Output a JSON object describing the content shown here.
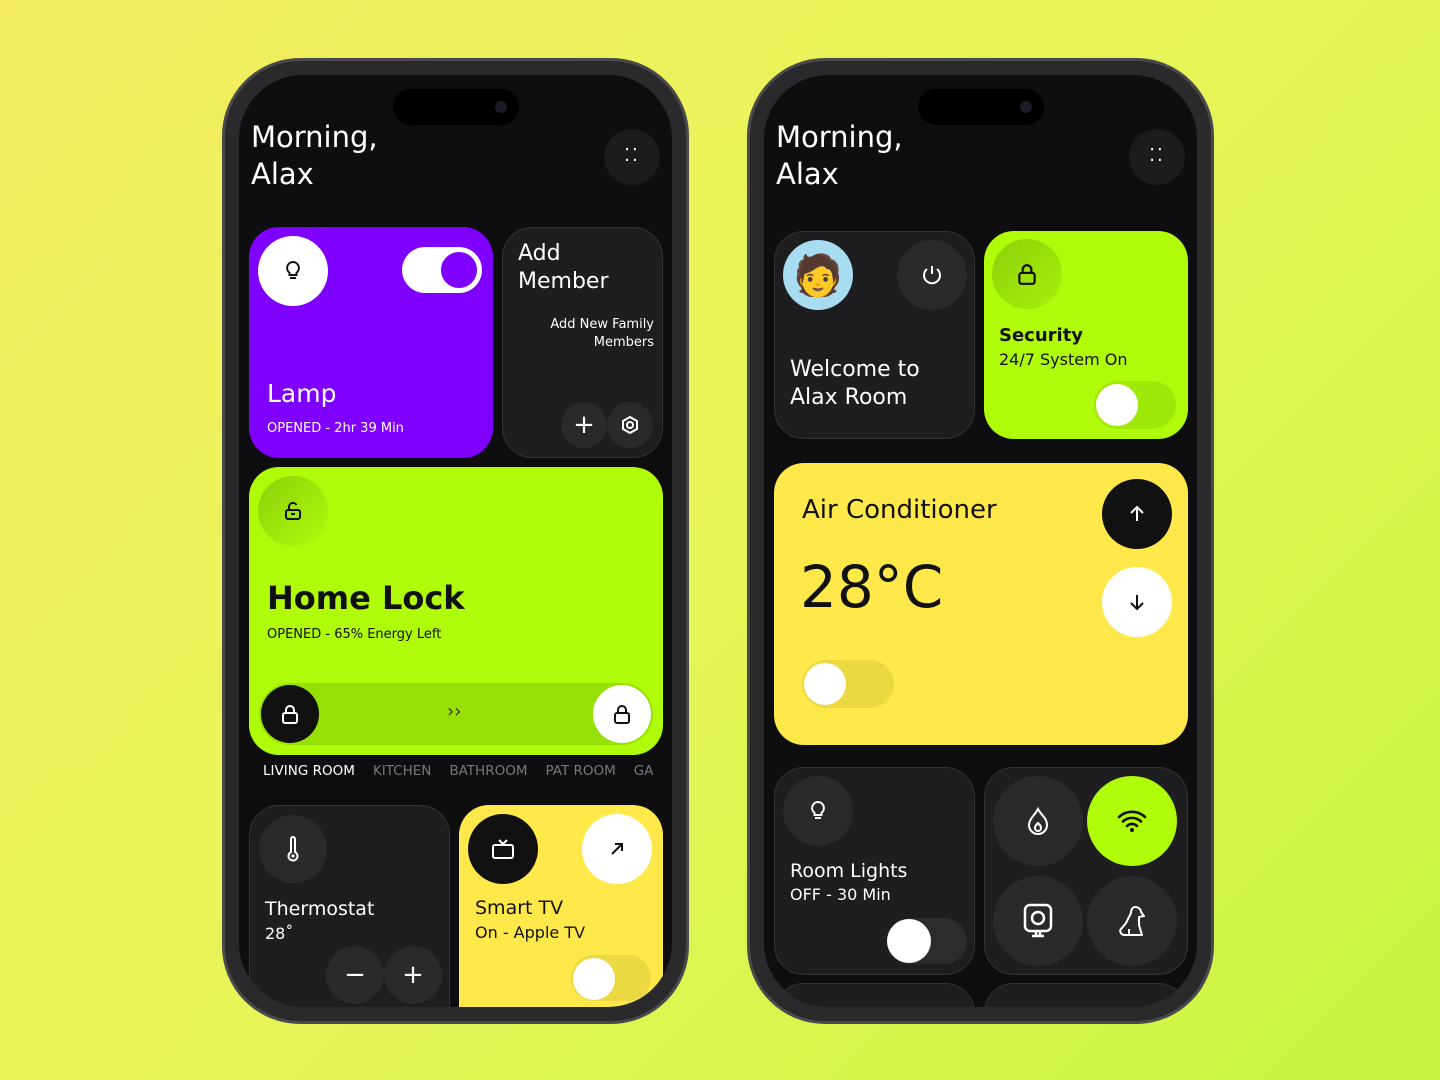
{
  "colors": {
    "purple": "#7f00ff",
    "lime": "#b0fb0a",
    "yellow": "#ffe94a",
    "dark": "#1e1e20"
  },
  "left": {
    "greeting_line1": "Morning,",
    "greeting_line2": "Alax",
    "menu_icon": "dots-grid-icon",
    "lamp": {
      "title": "Lamp",
      "status": "OPENED - 2hr 39 Min",
      "on": true
    },
    "add_member": {
      "title_line1": "Add",
      "title_line2": "Member",
      "subtitle_line1": "Add New Family",
      "subtitle_line2": "Members"
    },
    "home_lock": {
      "title": "Home Lock",
      "status": "OPENED - 65% Energy Left",
      "slider_hint": "››"
    },
    "rooms": [
      "LIVING ROOM",
      "KITCHEN",
      "BATHROOM",
      "PAT ROOM",
      "GA"
    ],
    "active_room": "LIVING ROOM",
    "thermostat": {
      "title": "Thermostat",
      "value": "28˚"
    },
    "smart_tv": {
      "title": "Smart TV",
      "status": "On - Apple TV",
      "on": false
    }
  },
  "right": {
    "greeting_line1": "Morning,",
    "greeting_line2": "Alax",
    "welcome": {
      "line1": "Welcome to",
      "line2": "Alax Room"
    },
    "security": {
      "title": "Security",
      "status": "24/7 System On",
      "on": false
    },
    "ac": {
      "title": "Air Conditioner",
      "temperature": "28°C",
      "on": false
    },
    "room_lights": {
      "title": "Room Lights",
      "status": "OFF - 30 Min",
      "on": false
    },
    "quick": [
      {
        "icon": "flame-icon",
        "active": false
      },
      {
        "icon": "wifi-icon",
        "active": true
      },
      {
        "icon": "speaker-icon",
        "active": false
      },
      {
        "icon": "dog-icon",
        "active": false
      }
    ]
  }
}
